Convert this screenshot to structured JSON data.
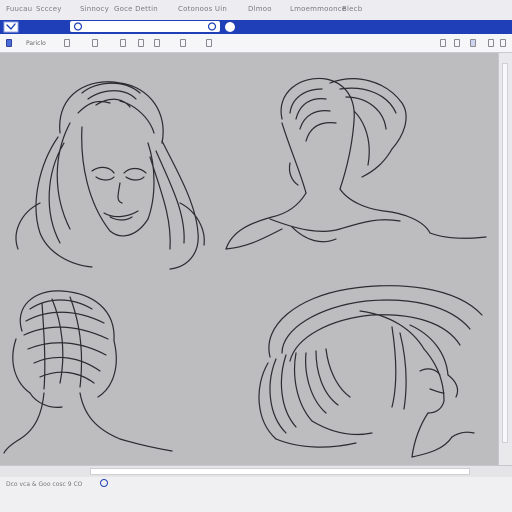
{
  "menubar": {
    "items": [
      "Fuucau",
      "Scccey",
      "Sinnocy",
      "Goce Dettin",
      "Cotonoos Uin",
      "Dlmoo",
      "Lmoemmoonce",
      "Blecb"
    ]
  },
  "toolbar": {
    "label": "Pariclo"
  },
  "status": {
    "text": "Dco vca & Goo cosc 9 CO"
  },
  "colors": {
    "accent": "#1f3fb8",
    "canvas": "#bdbdbf",
    "ink": "#2b2b31"
  },
  "sketches": [
    "woman-face-long-hair-sketch",
    "ponytail-back-view-sketch",
    "short-braided-hair-back-view-sketch",
    "long-flowing-hair-side-profile-sketch"
  ]
}
